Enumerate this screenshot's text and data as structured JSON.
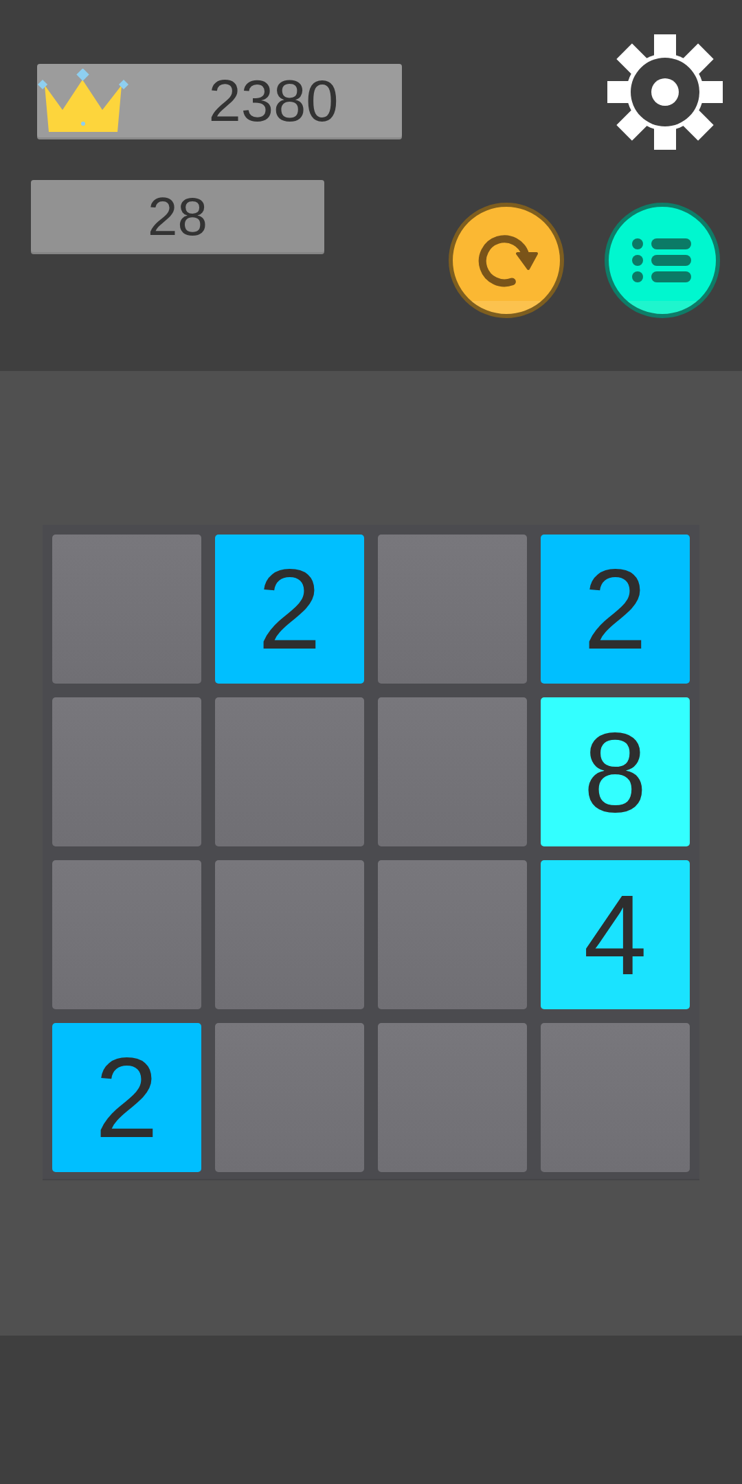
{
  "best_score": {
    "value": "2380"
  },
  "score": {
    "value": "28"
  },
  "board": {
    "rows": [
      {
        "tiles": [
          {
            "kind": "empty"
          },
          {
            "kind": "number",
            "value": "2",
            "color": "#00bfff"
          },
          {
            "kind": "empty"
          },
          {
            "kind": "number",
            "value": "2",
            "color": "#00bfff"
          }
        ]
      },
      {
        "tiles": [
          {
            "kind": "empty"
          },
          {
            "kind": "empty"
          },
          {
            "kind": "empty"
          },
          {
            "kind": "number",
            "value": "8",
            "color": "#33ffff"
          }
        ]
      },
      {
        "tiles": [
          {
            "kind": "empty"
          },
          {
            "kind": "empty"
          },
          {
            "kind": "empty"
          },
          {
            "kind": "number",
            "value": "4",
            "color": "#1ae3ff"
          }
        ]
      },
      {
        "tiles": [
          {
            "kind": "number",
            "value": "2",
            "color": "#00bfff"
          },
          {
            "kind": "empty"
          },
          {
            "kind": "empty"
          },
          {
            "kind": "empty"
          }
        ]
      }
    ]
  }
}
